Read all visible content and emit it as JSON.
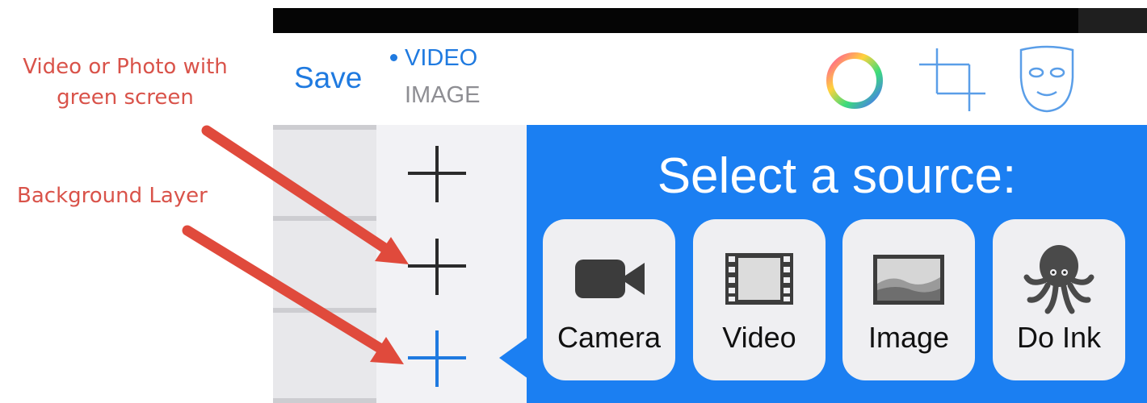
{
  "annotations": {
    "source_label_line1": "Video or Photo with",
    "source_label_line2": "green screen",
    "background_label": "Background Layer"
  },
  "toolbar": {
    "save_label": "Save",
    "modes": [
      "VIDEO",
      "IMAGE"
    ],
    "selected_mode": "VIDEO",
    "tools": [
      "color-wheel-icon",
      "crop-icon",
      "mask-icon"
    ]
  },
  "layers": {
    "add_buttons": 3,
    "selected_index": 2
  },
  "source_popover": {
    "title": "Select a source:",
    "options": [
      {
        "label": "Camera",
        "icon": "camera-icon"
      },
      {
        "label": "Video",
        "icon": "film-strip-icon"
      },
      {
        "label": "Image",
        "icon": "landscape-image-icon"
      },
      {
        "label": "Do Ink",
        "icon": "octopus-icon"
      }
    ]
  },
  "colors": {
    "accent": "#1f7ae0",
    "popover_bg": "#1b7ff2",
    "annotation": "#d9534a",
    "arrow": "#e04a3c"
  }
}
